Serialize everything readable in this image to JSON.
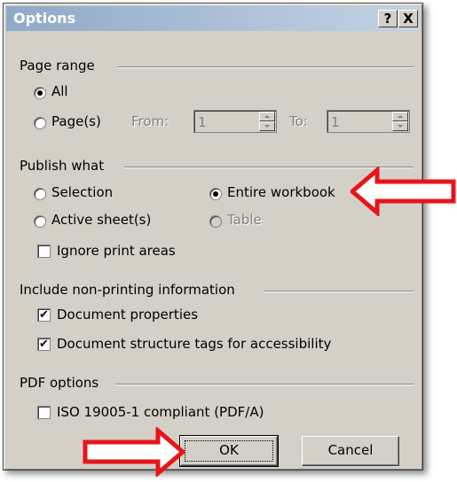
{
  "window": {
    "title": "Options",
    "help_label": "?",
    "close_label": "X"
  },
  "page_range": {
    "label": "Page range",
    "all_label": "All",
    "pages_label": "Page(s)",
    "from_label": "From:",
    "from_value": "1",
    "to_label": "To:",
    "to_value": "1"
  },
  "publish_what": {
    "label": "Publish what",
    "selection_label": "Selection",
    "entire_workbook_label": "Entire workbook",
    "active_sheets_label": "Active sheet(s)",
    "table_label": "Table",
    "ignore_print_areas_label": "Ignore print areas"
  },
  "non_printing": {
    "label": "Include non-printing information",
    "doc_properties_label": "Document properties",
    "doc_structure_label": "Document structure tags for accessibility"
  },
  "pdf_options": {
    "label": "PDF options",
    "iso_label": "ISO 19005-1 compliant (PDF/A)"
  },
  "buttons": {
    "ok_label": "OK",
    "cancel_label": "Cancel"
  },
  "colors": {
    "annotation_arrow": "#e8141a",
    "dialog_face": "#d4d0c8"
  },
  "icons": {
    "check_glyph": "✔"
  }
}
